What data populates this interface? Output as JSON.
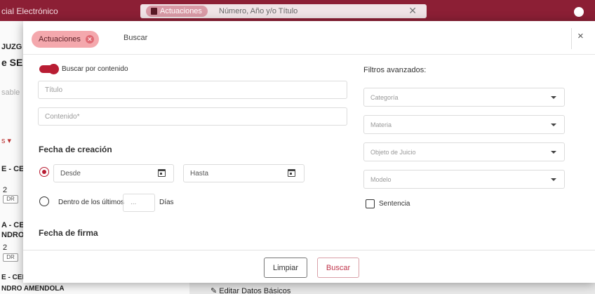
{
  "background": {
    "header_title": "cial Electrónico",
    "search": {
      "chip_label": "Actuaciones",
      "placeholder": "Número, Año y/o Título",
      "clear_glyph": "✕"
    },
    "side_texts": [
      "JUZG",
      "e SE",
      "sable",
      "s ▾",
      "E - CE",
      "2",
      "DR",
      "A - CE",
      "NDRO",
      "2",
      "DR",
      "E - CEDULA ELECTRONICA MANUEL",
      "NDRO AMENDOLA"
    ],
    "bottom_action": "Editar Datos Básicos"
  },
  "modal": {
    "tabs": {
      "active_label": "Actuaciones",
      "search_label": "Buscar"
    },
    "close_glyph": "×",
    "content_toggle_label": "Buscar por contenido",
    "fields": {
      "title_placeholder": "Título",
      "content_placeholder": "Contenido*"
    },
    "creation_date": {
      "heading": "Fecha de creación",
      "from_placeholder": "Desde",
      "to_placeholder": "Hasta",
      "within_last_label": "Dentro de los últimos",
      "days_placeholder": "...",
      "days_label": "Días"
    },
    "signature_date": {
      "heading": "Fecha de firma"
    },
    "advanced_filters": {
      "heading": "Filtros avanzados:",
      "category_placeholder": "Categoría",
      "subject_placeholder": "Materia",
      "object_placeholder": "Objeto de Juicio",
      "model_placeholder": "Modelo",
      "sentence_label": "Sentencia"
    },
    "footer": {
      "clear_button": "Limpiar",
      "search_button": "Buscar"
    }
  },
  "colors": {
    "brand": "#8c1f35",
    "accent": "#b81d33",
    "chip": "#f4a8ad"
  }
}
